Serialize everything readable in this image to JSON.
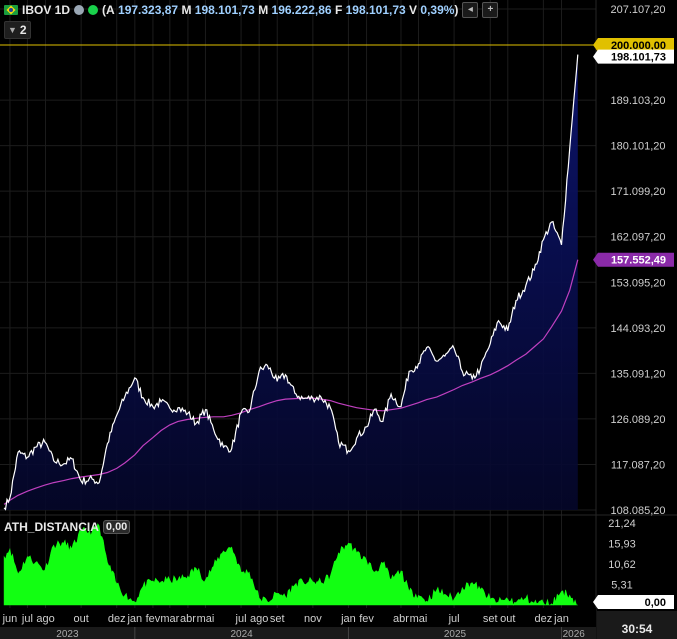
{
  "header": {
    "symbol": "IBOV 1D",
    "ohlc_open_label": "(A",
    "open": "197.323,87",
    "high_label": "M",
    "high": "198.101,73",
    "low_label": "M",
    "low": "196.222,86",
    "close_label": "F",
    "close": "198.101,73",
    "var_label": "V",
    "variation": "0,39%",
    "close_paren": ")",
    "indicator_count": "2"
  },
  "indicator": {
    "name": "ATH_DISTANCIA",
    "value": "0,00"
  },
  "time": "30:54",
  "colors": {
    "price": "#ffffff",
    "area": "#0a0f5c",
    "ma": "#c040c0",
    "ath": "#e0c000",
    "indicator": "#12ff12"
  },
  "chart_data": {
    "type": "line",
    "price_axis_ticks": [
      "207.107,20",
      "189.103,20",
      "180.101,20",
      "171.099,20",
      "162.097,20",
      "153.095,20",
      "144.093,20",
      "135.091,20",
      "126.089,20",
      "117.087,20",
      "108.085,20"
    ],
    "indicator_axis_ticks": [
      "21,24",
      "15,93",
      "10,62",
      "5,31"
    ],
    "months": [
      "jun",
      "jul",
      "ago",
      "out",
      "dez",
      "jan",
      "fev",
      "mar",
      "abr",
      "mai",
      "jul",
      "ago",
      "set",
      "nov",
      "jan",
      "fev",
      "abr",
      "mai",
      "jul",
      "set",
      "out",
      "dez",
      "jan"
    ],
    "years": [
      "2023",
      "2024",
      "2025",
      "2026"
    ],
    "tags": {
      "ath": "200.000,00",
      "last": "198.101,73",
      "ma": "157.552,49",
      "indicator": "0,00"
    },
    "ylim": [
      108085,
      207107
    ],
    "ind_ylim": [
      0,
      21.24
    ],
    "x": [
      "2023-05-22",
      "2023-06-01",
      "2023-06-15",
      "2023-07-01",
      "2023-07-15",
      "2023-07-31",
      "2023-08-15",
      "2023-09-01",
      "2023-09-15",
      "2023-10-01",
      "2023-10-20",
      "2023-11-01",
      "2023-11-15",
      "2023-12-01",
      "2023-12-15",
      "2024-01-01",
      "2024-01-15",
      "2024-02-01",
      "2024-02-15",
      "2024-03-01",
      "2024-03-15",
      "2024-04-01",
      "2024-04-15",
      "2024-05-01",
      "2024-05-15",
      "2024-06-01",
      "2024-06-15",
      "2024-07-01",
      "2024-07-15",
      "2024-08-01",
      "2024-08-15",
      "2024-09-01",
      "2024-09-15",
      "2024-10-01",
      "2024-10-15",
      "2024-11-01",
      "2024-11-15",
      "2024-12-01",
      "2024-12-15",
      "2025-01-01",
      "2025-01-15",
      "2025-02-01",
      "2025-02-15",
      "2025-03-01",
      "2025-03-15",
      "2025-04-01",
      "2025-04-15",
      "2025-05-01",
      "2025-05-15",
      "2025-06-01",
      "2025-06-15",
      "2025-07-01",
      "2025-07-15",
      "2025-08-01",
      "2025-08-15",
      "2025-09-01",
      "2025-09-15",
      "2025-10-01",
      "2025-10-15",
      "2025-11-01",
      "2025-11-15",
      "2025-12-01",
      "2025-12-15",
      "2026-01-01",
      "2026-01-15",
      "2026-01-29"
    ],
    "close": [
      108500,
      110500,
      119500,
      118500,
      120500,
      121500,
      117800,
      117200,
      118200,
      113800,
      114200,
      113500,
      121200,
      126800,
      130500,
      134200,
      130300,
      128500,
      129500,
      128200,
      128300,
      127200,
      125200,
      127900,
      124000,
      120500,
      120200,
      127300,
      127500,
      135500,
      136700,
      133500,
      134800,
      131200,
      130100,
      130200,
      130400,
      128300,
      121500,
      119800,
      122300,
      124500,
      128000,
      125600,
      131000,
      128500,
      135500,
      137000,
      140200,
      137500,
      138500,
      140000,
      135500,
      134000,
      136000,
      141000,
      145500,
      143500,
      149500,
      152500,
      155500,
      161500,
      165000,
      160500,
      179500,
      198101
    ],
    "ma": [
      109200,
      110000,
      111000,
      111800,
      112400,
      113000,
      113500,
      113900,
      114300,
      114600,
      114900,
      115100,
      115500,
      116300,
      117400,
      119000,
      120800,
      122400,
      123800,
      124900,
      125600,
      126000,
      126200,
      126400,
      126500,
      126500,
      126800,
      127300,
      127900,
      128500,
      129100,
      129700,
      130000,
      130100,
      130200,
      130200,
      130000,
      129700,
      129200,
      128700,
      128300,
      128000,
      127800,
      127700,
      127900,
      128200,
      128700,
      129300,
      129900,
      130400,
      131100,
      131900,
      132700,
      133400,
      134100,
      134800,
      135600,
      136600,
      137700,
      138900,
      140300,
      141900,
      144300,
      147400,
      151500,
      157552
    ],
    "ind": [
      12.5,
      14.5,
      8.0,
      12.5,
      11.0,
      9.0,
      15.5,
      16.0,
      14.5,
      19.0,
      19.0,
      20.5,
      11.0,
      5.5,
      2.5,
      0.8,
      4.8,
      6.2,
      6.0,
      6.5,
      6.5,
      7.5,
      9.5,
      6.5,
      10.0,
      14.0,
      15.0,
      8.5,
      8.5,
      1.8,
      0.9,
      3.0,
      2.2,
      5.2,
      6.0,
      6.0,
      5.8,
      7.5,
      13.5,
      16.0,
      13.5,
      11.5,
      8.5,
      10.8,
      6.5,
      8.8,
      3.5,
      2.5,
      1.0,
      3.8,
      2.8,
      1.5,
      4.5,
      5.8,
      4.0,
      1.5,
      0.8,
      1.5,
      0.6,
      1.8,
      0.5,
      0.6,
      0.3,
      3.5,
      2.5,
      0.0
    ]
  }
}
